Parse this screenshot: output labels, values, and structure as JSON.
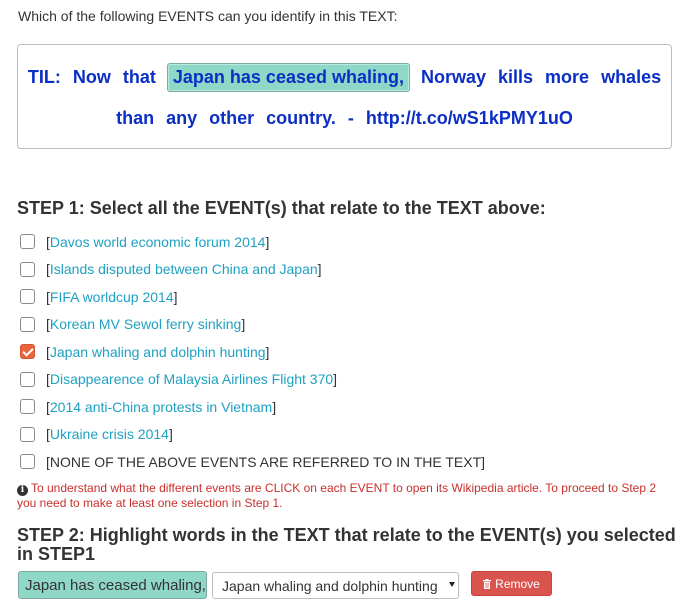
{
  "question": "Which of the following EVENTS can you identify in this TEXT:",
  "text": {
    "line1_before": [
      "TIL:",
      "Now",
      "that"
    ],
    "highlight": "Japan has ceased whaling,",
    "line1_after": [
      "Norway",
      "kills",
      "more",
      "whales"
    ],
    "line2": [
      "than",
      "any",
      "other",
      "country.",
      "-",
      "http://t.co/wS1kPMY1uO"
    ]
  },
  "step1": {
    "title": "STEP 1: Select all the EVENT(s) that relate to the TEXT above:",
    "events": [
      {
        "label": "Davos world economic forum 2014",
        "checked": false
      },
      {
        "label": "Islands disputed between China and Japan ",
        "checked": false
      },
      {
        "label": "FIFA worldcup 2014 ",
        "checked": false
      },
      {
        "label": "Korean MV Sewol ferry sinking ",
        "checked": false
      },
      {
        "label": "Japan whaling and dolphin hunting ",
        "checked": true
      },
      {
        "label": "Disappearence of Malaysia Airlines Flight 370 ",
        "checked": false
      },
      {
        "label": "2014 anti-China protests in Vietnam ",
        "checked": false
      },
      {
        "label": "Ukraine crisis 2014 ",
        "checked": false
      }
    ],
    "none_option": "NONE OF THE ABOVE EVENTS ARE REFERRED TO IN THE TEXT"
  },
  "info": {
    "icon": "info-icon",
    "message": "To understand what the different events are CLICK on each EVENT to open its Wikipedia article. To proceed to Step 2 you need to make at least one selection in Step 1."
  },
  "step2": {
    "title": "STEP 2: Highlight words in the TEXT that relate to the EVENT(s) you selected in STEP1",
    "selection": "Japan has ceased whaling,",
    "event_select_value": "Japan whaling and dolphin hunting",
    "remove_label": "Remove"
  },
  "colors": {
    "highlight": "#8fd8c7",
    "link": "#1ea1c2",
    "text_blue": "#0b2fc4",
    "checkbox_checked": "#e8663d",
    "warning": "#c9302c",
    "remove_button": "#d9534f"
  }
}
